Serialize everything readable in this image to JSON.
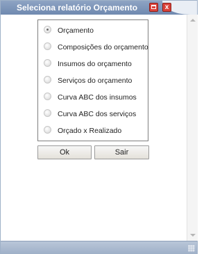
{
  "window": {
    "title": "Seleciona relatório Orçamento",
    "maximize_icon": "maximize-icon",
    "close_icon": "close-icon",
    "close_glyph": "x"
  },
  "report_options": [
    {
      "label": "Orçamento",
      "checked": true
    },
    {
      "label": "Composições do orçamento",
      "checked": false
    },
    {
      "label": "Insumos do orçamento",
      "checked": false
    },
    {
      "label": "Serviços do orçamento",
      "checked": false
    },
    {
      "label": "Curva ABC dos insumos",
      "checked": false
    },
    {
      "label": "Curva ABC dos serviços",
      "checked": false
    },
    {
      "label": "Orçado x Realizado",
      "checked": false
    }
  ],
  "buttons": {
    "ok_label": "Ok",
    "cancel_label": "Sair"
  },
  "colors": {
    "titlebar": "#7a93b8",
    "close_button": "#d9423a",
    "statusbar": "#a9b8ce"
  }
}
